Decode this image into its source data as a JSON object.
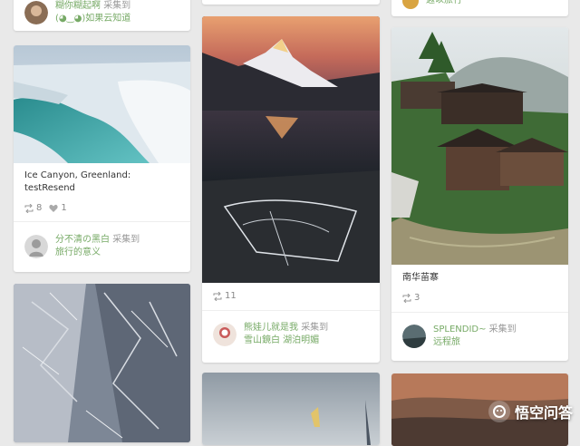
{
  "cards": {
    "top_left": {
      "user": "糊你糊起啊",
      "action": "采集到",
      "board": "(◕‿◕)如果云知道"
    },
    "ice_canyon": {
      "description": "Ice Canyon, Greenland: testResend",
      "repins": "8",
      "likes": "1",
      "user": "分不清の黑白",
      "action": "采集到",
      "board": "旅行的意义"
    },
    "mountain_lake": {
      "repins": "11",
      "user": "熊娃儿就是我",
      "action": "采集到",
      "board": "雪山鏡白 湖泊明媚"
    },
    "top_right": {
      "board": "遐以旅行"
    },
    "village": {
      "description": "南华苗寨",
      "repins": "3",
      "user": "SPLENDID~",
      "action": "采集到",
      "board": "远程旅"
    }
  },
  "watermark": {
    "text": "悟空问答"
  }
}
